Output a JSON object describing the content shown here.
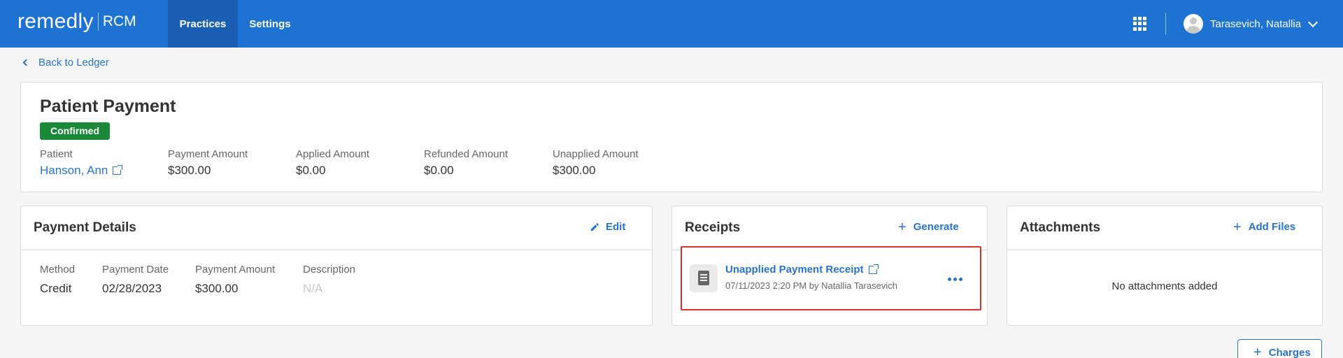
{
  "header": {
    "brand_name": "remedly",
    "brand_suffix": "RCM",
    "nav": [
      {
        "label": "Practices",
        "active": true
      },
      {
        "label": "Settings",
        "active": false
      }
    ],
    "apps_icon": "apps-grid-icon",
    "user_name": "Tarasevich, Natallia",
    "colors": {
      "bar": "#1e73d2",
      "active_tab": "#1a5fb4"
    }
  },
  "back_link": "Back to Ledger",
  "summary": {
    "title": "Patient Payment",
    "status": "Confirmed",
    "status_color": "#1b8a38",
    "fields": [
      {
        "label": "Patient",
        "value": "Hanson, Ann"
      },
      {
        "label": "Payment Amount",
        "value": "$300.00"
      },
      {
        "label": "Applied Amount",
        "value": "$0.00"
      },
      {
        "label": "Refunded Amount",
        "value": "$0.00"
      },
      {
        "label": "Unapplied Amount",
        "value": "$300.00"
      }
    ]
  },
  "payment_details": {
    "title": "Payment Details",
    "action": "Edit",
    "columns": [
      {
        "label": "Method",
        "value": "Credit"
      },
      {
        "label": "Payment Date",
        "value": "02/28/2023"
      },
      {
        "label": "Payment Amount",
        "value": "$300.00"
      },
      {
        "label": "Description",
        "value": "N/A"
      }
    ]
  },
  "receipts": {
    "title": "Receipts",
    "action": "Generate",
    "item": {
      "title": "Unapplied Payment Receipt",
      "meta": "07/11/2023 2:20 PM by Natallia Tarasevich"
    }
  },
  "attachments": {
    "title": "Attachments",
    "action": "Add Files",
    "empty_text": "No attachments added"
  },
  "charges_button": "Charges",
  "accent_color": "#2a73c8"
}
